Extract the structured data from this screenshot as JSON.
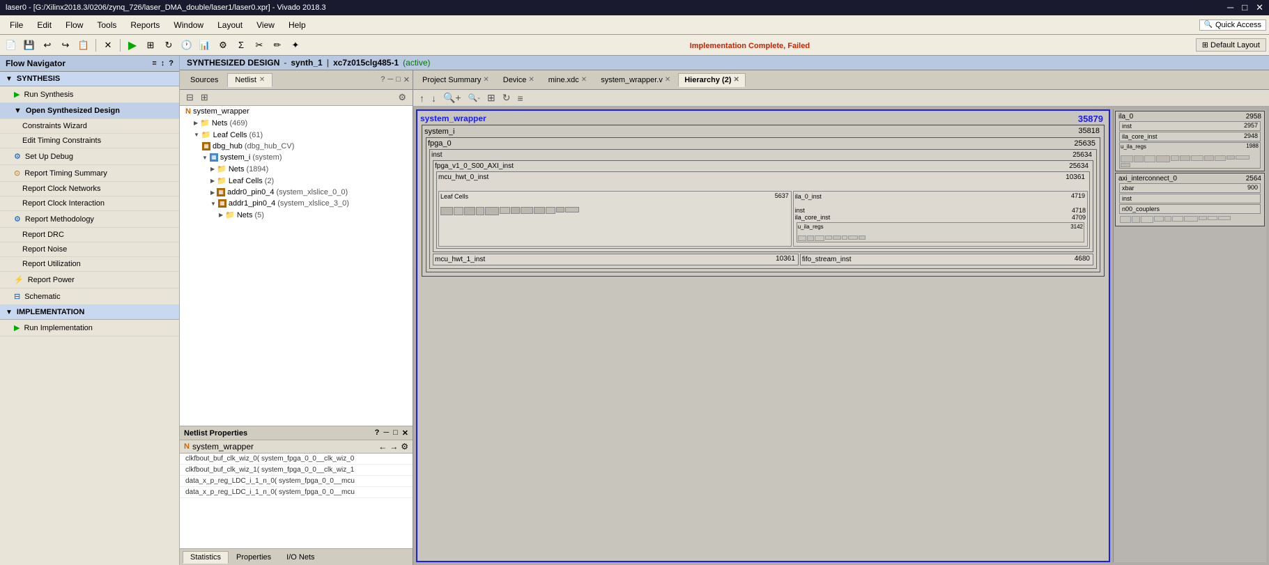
{
  "title_bar": {
    "text": "laser0 - [G:/Xilinx2018.3/0206/zynq_726/laser_DMA_double/laser1/laser0.xpr] - Vivado 2018.3"
  },
  "menu": {
    "items": [
      "File",
      "Edit",
      "Flow",
      "Tools",
      "Reports",
      "Window",
      "Layout",
      "View",
      "Help"
    ]
  },
  "toolbar": {
    "quick_access_placeholder": "Quick Access"
  },
  "status": {
    "text": "Implementation Complete, Failed",
    "default_layout": "Default Layout"
  },
  "flow_navigator": {
    "title": "Flow Navigator",
    "synthesis_section": "SYNTHESIS",
    "run_synthesis": "Run Synthesis",
    "open_synthesized_design": "Open Synthesized Design",
    "constraints_wizard": "Constraints Wizard",
    "edit_timing_constraints": "Edit Timing Constraints",
    "set_up_debug": "Set Up Debug",
    "report_timing_summary": "Report Timing Summary",
    "report_clock_networks": "Report Clock Networks",
    "report_clock_interaction": "Report Clock Interaction",
    "report_methodology": "Report Methodology",
    "report_drc": "Report DRC",
    "report_noise": "Report Noise",
    "report_utilization": "Report Utilization",
    "report_power": "Report Power",
    "schematic": "Schematic",
    "implementation_section": "IMPLEMENTATION",
    "run_implementation": "Run Implementation"
  },
  "synth_header": {
    "design": "SYNTHESIZED DESIGN",
    "synth": "synth_1",
    "part": "xc7z015clg485-1",
    "active": "(active)"
  },
  "tabs": {
    "sources": "Sources",
    "netlist": "Netlist",
    "project_summary": "Project Summary",
    "device": "Device",
    "mine_xdc": "mine.xdc",
    "system_wrapper_v": "system_wrapper.v",
    "hierarchy": "Hierarchy (2)"
  },
  "netlist": {
    "root": "system_wrapper",
    "nets_label": "Nets",
    "nets_count": "(469)",
    "leaf_cells_label": "Leaf Cells",
    "leaf_cells_count": "(61)",
    "dbg_hub": "dbg_hub",
    "dbg_hub_type": "(dbg_hub_CV)",
    "system_i_label": "system_i",
    "system_i_type": "(system)",
    "system_i_nets": "Nets",
    "system_i_nets_count": "(1894)",
    "system_i_leaf": "Leaf Cells",
    "system_i_leaf_count": "(2)",
    "addr0_pin0_4": "addr0_pin0_4",
    "addr0_type": "(system_xlslice_0_0)",
    "addr1_pin0_4": "addr1_pin0_4",
    "addr1_type": "(system_xlslice_3_0)",
    "nets_5": "Nets",
    "nets_5_count": "(5)"
  },
  "netlist_properties": {
    "title": "Netlist Properties",
    "root_node": "system_wrapper",
    "items": [
      "clkfbout_buf_clk_wiz_0( system_fpga_0_0__clk_wiz_0",
      "clkfbout_buf_clk_wiz_1( system_fpga_0_0__clk_wiz_1",
      "data_x_p_reg_LDC_i_1_n_0( system_fpga_0_0__mcu",
      "data_x_p_reg_LDC_i_1_n_0( system_fpga_0_0__mcu"
    ]
  },
  "bottom_tabs": {
    "statistics": "Statistics",
    "properties": "Properties",
    "io_nets": "I/O Nets"
  },
  "hierarchy_view": {
    "system_wrapper_title": "system_wrapper",
    "system_wrapper_count": "35879",
    "system_i_title": "system_i",
    "system_i_count": "35818",
    "fpga_0_title": "fpga_0",
    "fpga_0_count": "25635",
    "inst_title": "inst",
    "inst_count": "25634",
    "fpga_v1_title": "fpga_v1_0_S00_AXI_inst",
    "fpga_v1_count": "25634",
    "mcu_hwt_0_title": "mcu_hwt_0_inst",
    "mcu_hwt_0_count": "10361",
    "leaf_cells_title": "Leaf Cells",
    "leaf_cells_count": "5637",
    "ila_0_inst_title": "ila_0_inst",
    "ila_0_inst_count": "4719",
    "ila_inst_title": "inst",
    "ila_inst_count": "4718",
    "ila_core_inst_title": "ila_core_inst",
    "ila_core_inst_count": "4709",
    "u_ila_regs_title": "u_ila_regs",
    "u_ila_regs_count": "3142",
    "mcu_hwt_1_title": "mcu_hwt_1_inst",
    "mcu_hwt_1_count": "10361",
    "fifo_stream_title": "fifo_stream_inst",
    "fifo_stream_count": "4680",
    "ila_0_title": "ila_0",
    "ila_0_count": "2958",
    "ila_0_inst_r": "inst",
    "ila_0_inst_r_count": "2957",
    "ila_core_inst_r": "ila_core_inst",
    "ila_core_inst_r_count": "2948",
    "u_ila_regs_r": "u_ila_regs",
    "u_ila_regs_r_count": "1988",
    "axi_interconnect_0_title": "axi_interconnect_0",
    "axi_interconnect_0_count": "2564",
    "xbar_title": "xbar",
    "xbar_count": "900",
    "xbar_inst": "inst",
    "n00_couplers_title": "n00_couplers"
  }
}
